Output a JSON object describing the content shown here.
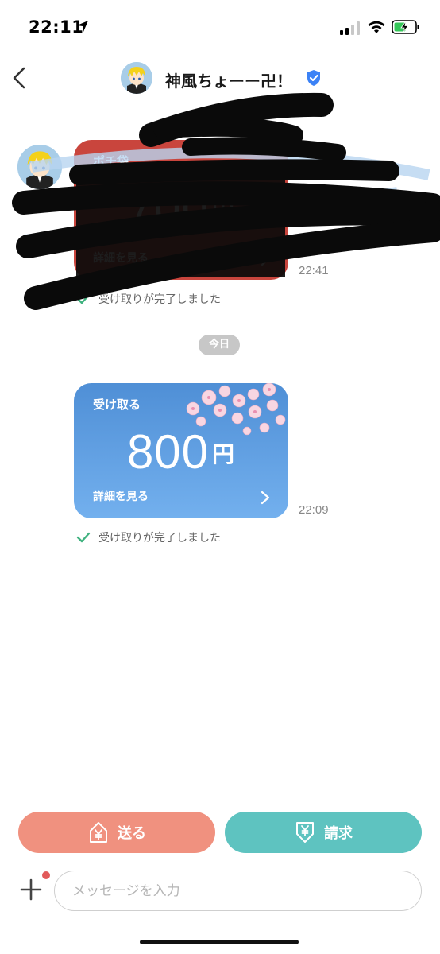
{
  "status_bar": {
    "time": "22:11",
    "icons": [
      "location-arrow-icon",
      "cellular-signal-icon",
      "wifi-icon",
      "battery-charging-icon"
    ]
  },
  "header": {
    "title": "神風ちょーー卍！",
    "back_icon": "chevron-left-icon",
    "verified_icon": "verified-badge-icon"
  },
  "messages": [
    {
      "card_type": "pochi-bukuro",
      "label": "ポチ袋",
      "amount": "700",
      "currency": "円",
      "details": "詳細を見る",
      "time": "22:41",
      "status": "受け取りが完了しました",
      "color": "#c9453d"
    },
    {
      "card_type": "receive",
      "label": "受け取る",
      "amount": "800",
      "currency": "円",
      "details": "詳細を見る",
      "time": "22:09",
      "status": "受け取りが完了しました",
      "color": "#5a98dc"
    }
  ],
  "date_separator": "今日",
  "actions": {
    "send_label": "送る",
    "request_label": "請求",
    "send_color": "#f0917f",
    "request_color": "#5ec3c0"
  },
  "composer": {
    "placeholder": "メッセージを入力",
    "value": ""
  },
  "colors": {
    "check": "#3fb27f",
    "verified": "#3b82f6"
  }
}
